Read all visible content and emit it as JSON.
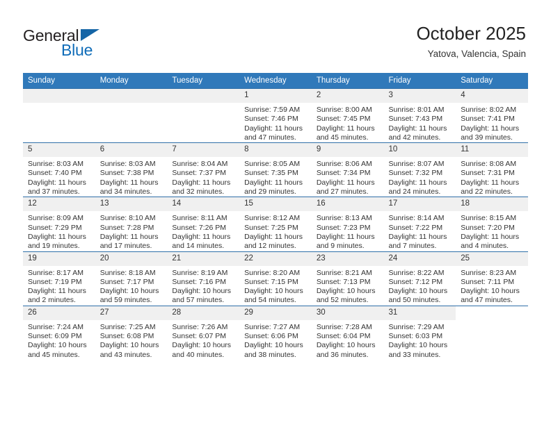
{
  "brand": {
    "name_part1": "General",
    "name_part2": "Blue",
    "accent_color": "#0f6cb8",
    "triangle_color": "#1565a6"
  },
  "header": {
    "title": "October 2025",
    "subtitle": "Yatova, Valencia, Spain"
  },
  "theme": {
    "header_row_bg": "#3079ba",
    "row_divider": "#2f6fa8",
    "daynum_bg": "#f0f0f0"
  },
  "labels": {
    "sunrise_prefix": "Sunrise:",
    "sunset_prefix": "Sunset:",
    "daylight_prefix": "Daylight:"
  },
  "weekdays": [
    "Sunday",
    "Monday",
    "Tuesday",
    "Wednesday",
    "Thursday",
    "Friday",
    "Saturday"
  ],
  "weeks": [
    [
      {
        "day": "",
        "empty": true
      },
      {
        "day": "",
        "empty": true
      },
      {
        "day": "",
        "empty": true
      },
      {
        "day": "1",
        "sunrise": "Sunrise: 7:59 AM",
        "sunset": "Sunset: 7:46 PM",
        "daylight_1": "Daylight: 11 hours",
        "daylight_2": "and 47 minutes."
      },
      {
        "day": "2",
        "sunrise": "Sunrise: 8:00 AM",
        "sunset": "Sunset: 7:45 PM",
        "daylight_1": "Daylight: 11 hours",
        "daylight_2": "and 45 minutes."
      },
      {
        "day": "3",
        "sunrise": "Sunrise: 8:01 AM",
        "sunset": "Sunset: 7:43 PM",
        "daylight_1": "Daylight: 11 hours",
        "daylight_2": "and 42 minutes."
      },
      {
        "day": "4",
        "sunrise": "Sunrise: 8:02 AM",
        "sunset": "Sunset: 7:41 PM",
        "daylight_1": "Daylight: 11 hours",
        "daylight_2": "and 39 minutes."
      }
    ],
    [
      {
        "day": "5",
        "sunrise": "Sunrise: 8:03 AM",
        "sunset": "Sunset: 7:40 PM",
        "daylight_1": "Daylight: 11 hours",
        "daylight_2": "and 37 minutes."
      },
      {
        "day": "6",
        "sunrise": "Sunrise: 8:03 AM",
        "sunset": "Sunset: 7:38 PM",
        "daylight_1": "Daylight: 11 hours",
        "daylight_2": "and 34 minutes."
      },
      {
        "day": "7",
        "sunrise": "Sunrise: 8:04 AM",
        "sunset": "Sunset: 7:37 PM",
        "daylight_1": "Daylight: 11 hours",
        "daylight_2": "and 32 minutes."
      },
      {
        "day": "8",
        "sunrise": "Sunrise: 8:05 AM",
        "sunset": "Sunset: 7:35 PM",
        "daylight_1": "Daylight: 11 hours",
        "daylight_2": "and 29 minutes."
      },
      {
        "day": "9",
        "sunrise": "Sunrise: 8:06 AM",
        "sunset": "Sunset: 7:34 PM",
        "daylight_1": "Daylight: 11 hours",
        "daylight_2": "and 27 minutes."
      },
      {
        "day": "10",
        "sunrise": "Sunrise: 8:07 AM",
        "sunset": "Sunset: 7:32 PM",
        "daylight_1": "Daylight: 11 hours",
        "daylight_2": "and 24 minutes."
      },
      {
        "day": "11",
        "sunrise": "Sunrise: 8:08 AM",
        "sunset": "Sunset: 7:31 PM",
        "daylight_1": "Daylight: 11 hours",
        "daylight_2": "and 22 minutes."
      }
    ],
    [
      {
        "day": "12",
        "sunrise": "Sunrise: 8:09 AM",
        "sunset": "Sunset: 7:29 PM",
        "daylight_1": "Daylight: 11 hours",
        "daylight_2": "and 19 minutes."
      },
      {
        "day": "13",
        "sunrise": "Sunrise: 8:10 AM",
        "sunset": "Sunset: 7:28 PM",
        "daylight_1": "Daylight: 11 hours",
        "daylight_2": "and 17 minutes."
      },
      {
        "day": "14",
        "sunrise": "Sunrise: 8:11 AM",
        "sunset": "Sunset: 7:26 PM",
        "daylight_1": "Daylight: 11 hours",
        "daylight_2": "and 14 minutes."
      },
      {
        "day": "15",
        "sunrise": "Sunrise: 8:12 AM",
        "sunset": "Sunset: 7:25 PM",
        "daylight_1": "Daylight: 11 hours",
        "daylight_2": "and 12 minutes."
      },
      {
        "day": "16",
        "sunrise": "Sunrise: 8:13 AM",
        "sunset": "Sunset: 7:23 PM",
        "daylight_1": "Daylight: 11 hours",
        "daylight_2": "and 9 minutes."
      },
      {
        "day": "17",
        "sunrise": "Sunrise: 8:14 AM",
        "sunset": "Sunset: 7:22 PM",
        "daylight_1": "Daylight: 11 hours",
        "daylight_2": "and 7 minutes."
      },
      {
        "day": "18",
        "sunrise": "Sunrise: 8:15 AM",
        "sunset": "Sunset: 7:20 PM",
        "daylight_1": "Daylight: 11 hours",
        "daylight_2": "and 4 minutes."
      }
    ],
    [
      {
        "day": "19",
        "sunrise": "Sunrise: 8:17 AM",
        "sunset": "Sunset: 7:19 PM",
        "daylight_1": "Daylight: 11 hours",
        "daylight_2": "and 2 minutes."
      },
      {
        "day": "20",
        "sunrise": "Sunrise: 8:18 AM",
        "sunset": "Sunset: 7:17 PM",
        "daylight_1": "Daylight: 10 hours",
        "daylight_2": "and 59 minutes."
      },
      {
        "day": "21",
        "sunrise": "Sunrise: 8:19 AM",
        "sunset": "Sunset: 7:16 PM",
        "daylight_1": "Daylight: 10 hours",
        "daylight_2": "and 57 minutes."
      },
      {
        "day": "22",
        "sunrise": "Sunrise: 8:20 AM",
        "sunset": "Sunset: 7:15 PM",
        "daylight_1": "Daylight: 10 hours",
        "daylight_2": "and 54 minutes."
      },
      {
        "day": "23",
        "sunrise": "Sunrise: 8:21 AM",
        "sunset": "Sunset: 7:13 PM",
        "daylight_1": "Daylight: 10 hours",
        "daylight_2": "and 52 minutes."
      },
      {
        "day": "24",
        "sunrise": "Sunrise: 8:22 AM",
        "sunset": "Sunset: 7:12 PM",
        "daylight_1": "Daylight: 10 hours",
        "daylight_2": "and 50 minutes."
      },
      {
        "day": "25",
        "sunrise": "Sunrise: 8:23 AM",
        "sunset": "Sunset: 7:11 PM",
        "daylight_1": "Daylight: 10 hours",
        "daylight_2": "and 47 minutes."
      }
    ],
    [
      {
        "day": "26",
        "sunrise": "Sunrise: 7:24 AM",
        "sunset": "Sunset: 6:09 PM",
        "daylight_1": "Daylight: 10 hours",
        "daylight_2": "and 45 minutes."
      },
      {
        "day": "27",
        "sunrise": "Sunrise: 7:25 AM",
        "sunset": "Sunset: 6:08 PM",
        "daylight_1": "Daylight: 10 hours",
        "daylight_2": "and 43 minutes."
      },
      {
        "day": "28",
        "sunrise": "Sunrise: 7:26 AM",
        "sunset": "Sunset: 6:07 PM",
        "daylight_1": "Daylight: 10 hours",
        "daylight_2": "and 40 minutes."
      },
      {
        "day": "29",
        "sunrise": "Sunrise: 7:27 AM",
        "sunset": "Sunset: 6:06 PM",
        "daylight_1": "Daylight: 10 hours",
        "daylight_2": "and 38 minutes."
      },
      {
        "day": "30",
        "sunrise": "Sunrise: 7:28 AM",
        "sunset": "Sunset: 6:04 PM",
        "daylight_1": "Daylight: 10 hours",
        "daylight_2": "and 36 minutes."
      },
      {
        "day": "31",
        "sunrise": "Sunrise: 7:29 AM",
        "sunset": "Sunset: 6:03 PM",
        "daylight_1": "Daylight: 10 hours",
        "daylight_2": "and 33 minutes."
      },
      {
        "day": "",
        "blank": true
      }
    ]
  ]
}
